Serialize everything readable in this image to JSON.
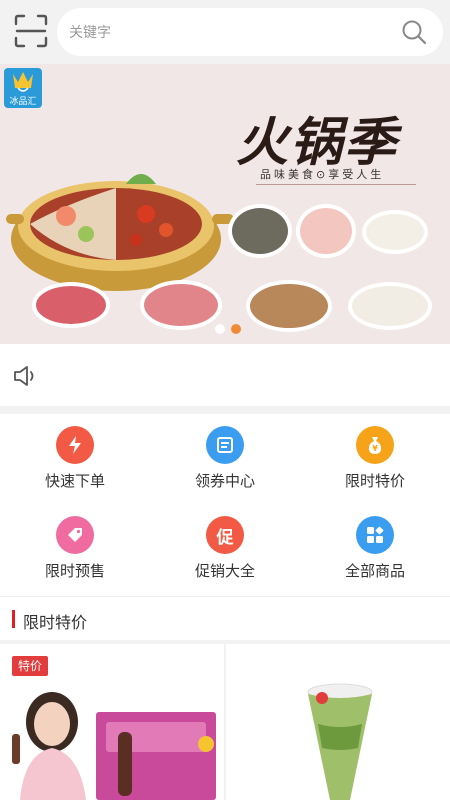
{
  "search": {
    "placeholder": "关键字"
  },
  "banner": {
    "logo_text": "冰品汇",
    "title": "火锅季",
    "subtitle": "品味美食⊙享受人生",
    "slide_count": 2,
    "active_slide": 2
  },
  "menu": {
    "items": [
      {
        "label": "快速下单",
        "icon": "lightning-icon",
        "color": "#f25a45"
      },
      {
        "label": "领券中心",
        "icon": "coupon-icon",
        "color": "#3b9df0"
      },
      {
        "label": "限时特价",
        "icon": "money-bag-icon",
        "color": "#f7a31a"
      },
      {
        "label": "限时预售",
        "icon": "tag-icon",
        "color": "#f06ba0"
      },
      {
        "label": "促销大全",
        "icon": "promo-icon",
        "color": "#f25a45",
        "glyph": "促"
      },
      {
        "label": "全部商品",
        "icon": "grid-icon",
        "color": "#3b9df0"
      }
    ]
  },
  "section": {
    "title": "限时特价"
  },
  "products": [
    {
      "badge": "特价"
    },
    {
      "badge": ""
    }
  ],
  "colors": {
    "accent": "#e02020",
    "badge": "#e23c3c",
    "dot_active": "#f08a35",
    "dot_inactive": "#ffffff"
  }
}
